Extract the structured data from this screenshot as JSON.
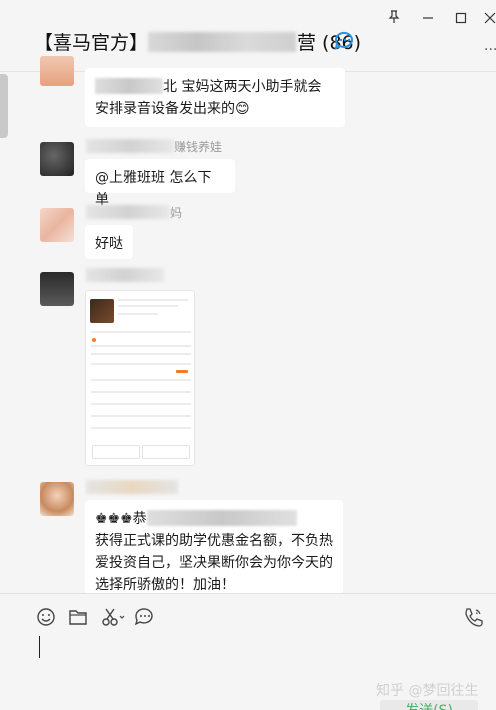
{
  "title": {
    "prefix": "【喜马官方】",
    "tail": "营",
    "count": "(86)"
  },
  "window_buttons": {
    "pin": "⊥",
    "min": "—",
    "max": "☐",
    "close": "✕",
    "more": "···"
  },
  "messages": [
    {
      "text_visible": "北  宝妈这两天小助手就会",
      "line2": "安排录音设备发出来的",
      "emoji": "😊"
    },
    {
      "nickname_tail": "赚钱养娃",
      "text": "@上雅班班 怎么下单"
    },
    {
      "nickname_tail": "妈",
      "text": "好哒"
    },
    {
      "type": "image"
    },
    {
      "prefix": "♚♚♚恭",
      "lines": [
        "获得正式课的助学优惠金名额，不负热",
        "爱投资自己，坚决果断你会为你今天的",
        "选择所骄傲的！加油！"
      ]
    }
  ],
  "input": {
    "send_label": "发送(S)"
  },
  "watermark": "知乎 @梦回往生"
}
